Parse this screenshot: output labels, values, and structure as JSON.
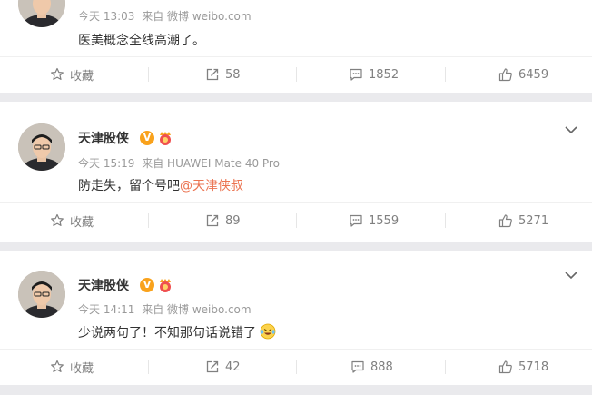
{
  "posts": [
    {
      "time": "今天 13:03",
      "source": "来自 微博 weibo.com",
      "content": "医美概念全线高潮了。",
      "actions": {
        "collect": "收藏",
        "repost": "58",
        "comment": "1852",
        "like": "6459"
      }
    },
    {
      "author": "天津股侠",
      "verified_badge": "V",
      "time": "今天 15:19",
      "source": "来自 HUAWEI Mate 40 Pro",
      "content": "防走失，留个号吧",
      "mention": "@天津侠叔",
      "actions": {
        "collect": "收藏",
        "repost": "89",
        "comment": "1559",
        "like": "5271"
      }
    },
    {
      "author": "天津股侠",
      "verified_badge": "V",
      "time": "今天 14:11",
      "source": "来自 微博 weibo.com",
      "content": "少说两句了！不知那句话说错了",
      "emoji": "laughing-tears-emoji",
      "actions": {
        "collect": "收藏",
        "repost": "42",
        "comment": "888",
        "like": "5718"
      }
    }
  ],
  "colors": {
    "mention": "#eb7350",
    "badge": "#f9a21c",
    "meta": "#999999",
    "action": "#808080"
  }
}
